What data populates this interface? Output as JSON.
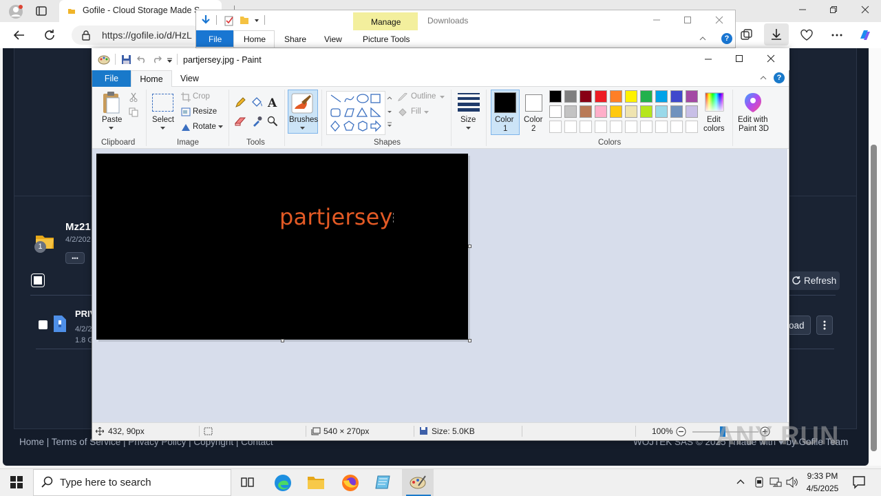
{
  "browser": {
    "tab_title": "Gofile - Cloud Storage Made Si",
    "url": "https://gofile.io/d/HzL",
    "page": {
      "folder_name": "Mz21",
      "folder_date": "4/2/202",
      "folder_badge": "1",
      "more_label": "•••",
      "refresh_label": "Refresh",
      "file_name": "PRIV",
      "file_date": "4/2/2",
      "file_size": "1.8 G",
      "download_label": "load",
      "footer_links": "Home  |  Terms of Service  |  Privacy Policy  |  Copyright  |  Contact",
      "footer_right": "WOJTEK SAS © 2025 | made with ♥ by Gofile Team"
    }
  },
  "explorer": {
    "manage_label": "Manage",
    "window_title": "Downloads",
    "tabs": [
      "File",
      "Home",
      "Share",
      "View"
    ],
    "picture_tools": "Picture Tools"
  },
  "paint": {
    "title": "partjersey.jpg - Paint",
    "tabs": {
      "file": "File",
      "home": "Home",
      "view": "View"
    },
    "clipboard": {
      "paste": "Paste",
      "group": "Clipboard"
    },
    "image": {
      "select": "Select",
      "crop": "Crop",
      "resize": "Resize",
      "rotate": "Rotate",
      "group": "Image"
    },
    "tools": {
      "group": "Tools"
    },
    "brushes": "Brushes",
    "shapes": {
      "outline": "Outline",
      "fill": "Fill",
      "group": "Shapes"
    },
    "size": "Size",
    "color1": "Color\n1",
    "color1_a": "Color",
    "color1_b": "1",
    "color2_a": "Color",
    "color2_b": "2",
    "colors_group": "Colors",
    "edit_colors_a": "Edit",
    "edit_colors_b": "colors",
    "edit3d_a": "Edit with",
    "edit3d_b": "Paint 3D",
    "palette_row1": [
      "#000000",
      "#7f7f7f",
      "#880015",
      "#ed1c24",
      "#ff7f27",
      "#fff200",
      "#22b14c",
      "#00a2e8",
      "#3f48cc",
      "#a349a4"
    ],
    "palette_row2": [
      "#ffffff",
      "#c3c3c3",
      "#b97a57",
      "#ffaec9",
      "#ffc90e",
      "#efe4b0",
      "#b5e61d",
      "#99d9ea",
      "#7092be",
      "#c8bfe7"
    ],
    "canvas_text": "partjersey",
    "canvas_text_color": "#e35a25",
    "status": {
      "cursor_pos": "432, 90px",
      "dimensions": "540 × 270px",
      "file_size": "Size: 5.0KB",
      "zoom": "100%"
    }
  },
  "taskbar": {
    "search_placeholder": "Type here to search",
    "time": "9:33 PM",
    "date": "4/5/2025"
  },
  "watermark": "ANY RUN"
}
